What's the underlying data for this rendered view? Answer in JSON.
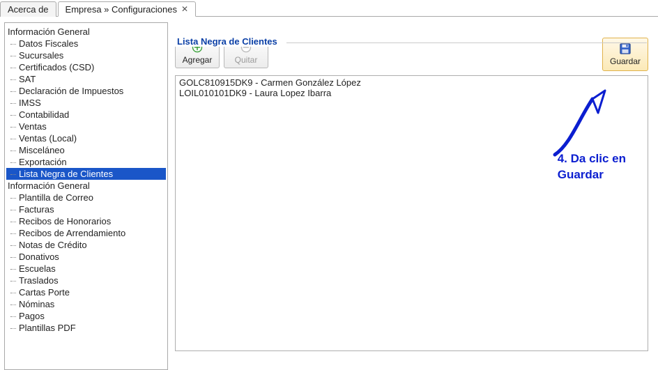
{
  "tabs": [
    {
      "label": "Acerca de",
      "closable": false,
      "active": false
    },
    {
      "label": "Empresa » Configuraciones",
      "closable": true,
      "active": true
    }
  ],
  "tree": {
    "groups": [
      {
        "label": "Información General",
        "items": [
          {
            "label": "Datos Fiscales",
            "selected": false
          },
          {
            "label": "Sucursales",
            "selected": false
          },
          {
            "label": "Certificados (CSD)",
            "selected": false
          },
          {
            "label": "SAT",
            "selected": false
          },
          {
            "label": "Declaración de Impuestos",
            "selected": false
          },
          {
            "label": "IMSS",
            "selected": false
          },
          {
            "label": "Contabilidad",
            "selected": false
          },
          {
            "label": "Ventas",
            "selected": false
          },
          {
            "label": "Ventas (Local)",
            "selected": false
          },
          {
            "label": "Misceláneo",
            "selected": false
          },
          {
            "label": "Exportación",
            "selected": false
          },
          {
            "label": "Lista Negra de Clientes",
            "selected": true
          }
        ]
      },
      {
        "label": "Información General",
        "items": [
          {
            "label": "Plantilla de Correo",
            "selected": false
          },
          {
            "label": "Facturas",
            "selected": false
          },
          {
            "label": "Recibos de Honorarios",
            "selected": false
          },
          {
            "label": "Recibos de Arrendamiento",
            "selected": false
          },
          {
            "label": "Notas de Crédito",
            "selected": false
          },
          {
            "label": "Donativos",
            "selected": false
          },
          {
            "label": "Escuelas",
            "selected": false
          },
          {
            "label": "Traslados",
            "selected": false
          },
          {
            "label": "Cartas Porte",
            "selected": false
          },
          {
            "label": "Nóminas",
            "selected": false
          },
          {
            "label": "Pagos",
            "selected": false
          },
          {
            "label": "Plantillas PDF",
            "selected": false
          }
        ]
      }
    ]
  },
  "panel": {
    "legend": "Lista Negra de Clientes",
    "buttons": {
      "add": "Agregar",
      "remove": "Quitar",
      "save": "Guardar"
    },
    "list": [
      "GOLC810915DK9 - Carmen González López",
      "LOIL010101DK9 - Laura Lopez Ibarra"
    ]
  },
  "annotation": {
    "line1": "4. Da clic en",
    "line2": "Guardar"
  },
  "colors": {
    "selection": "#1a56c8",
    "legend": "#0a3fa6",
    "annotation": "#0b1ed0"
  }
}
